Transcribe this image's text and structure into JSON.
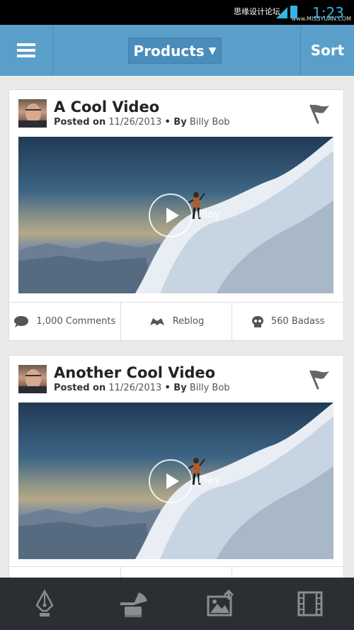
{
  "status_bar": {
    "time": "1:23",
    "watermark_text": "思缘设计论坛",
    "watermark_url": "www.MISSYUAN.COM"
  },
  "header": {
    "dropdown_label": "Products",
    "sort_label": "Sort",
    "menu_icon": "hamburger-menu-icon"
  },
  "posts": [
    {
      "title": "A Cool Video",
      "posted_on_label": "Posted on",
      "date": "11/26/2013",
      "by_label": "• By",
      "author": "Billy Bob",
      "play_label": "Play",
      "actions": {
        "comments": "1,000 Comments",
        "reblog": "Reblog",
        "badass": "560 Badass"
      }
    },
    {
      "title": "Another Cool Video",
      "posted_on_label": "Posted on",
      "date": "11/26/2013",
      "by_label": "• By",
      "author": "Billy Bob",
      "play_label": "Play"
    }
  ],
  "bottom_nav": [
    "pen-nib-icon",
    "gramophone-icon",
    "image-upload-icon",
    "film-strip-icon"
  ],
  "colors": {
    "header": "#5a9fca",
    "background": "#e9eaea",
    "bottom_nav": "#2b2f34",
    "status_accent": "#33b5e5"
  }
}
